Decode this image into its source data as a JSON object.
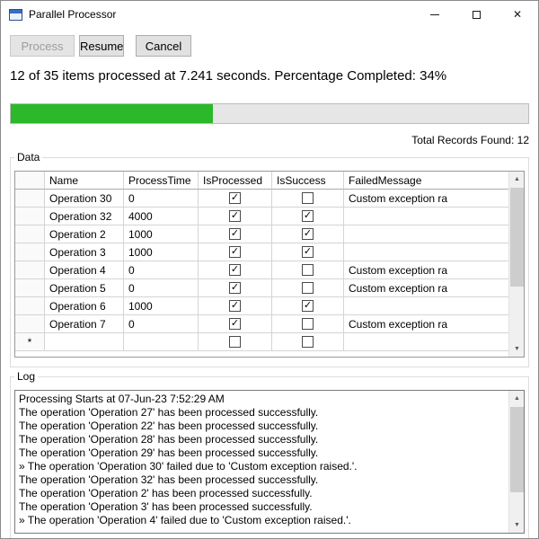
{
  "window": {
    "title": "Parallel Processor"
  },
  "toolbar": {
    "process_label": "Process",
    "resume_label": "Resume",
    "cancel_label": "Cancel"
  },
  "status": {
    "text": "12 of 35 items processed at 7.241 seconds. Percentage Completed: 34%",
    "progress_percent": 34,
    "progress_fill_percent": 39,
    "progress_color": "#2bb82b",
    "total_records": "Total Records Found: 12"
  },
  "data_group": {
    "label": "Data",
    "columns": [
      "Name",
      "ProcessTime",
      "IsProcessed",
      "IsSuccess",
      "FailedMessage"
    ],
    "rows": [
      {
        "row_header": "",
        "name": "Operation 30",
        "process_time": "0",
        "is_processed": true,
        "is_success": false,
        "failed_message": "Custom exception ra"
      },
      {
        "row_header": "",
        "name": "Operation 32",
        "process_time": "4000",
        "is_processed": true,
        "is_success": true,
        "failed_message": ""
      },
      {
        "row_header": "",
        "name": "Operation 2",
        "process_time": "1000",
        "is_processed": true,
        "is_success": true,
        "failed_message": ""
      },
      {
        "row_header": "",
        "name": "Operation 3",
        "process_time": "1000",
        "is_processed": true,
        "is_success": true,
        "failed_message": ""
      },
      {
        "row_header": "",
        "name": "Operation 4",
        "process_time": "0",
        "is_processed": true,
        "is_success": false,
        "failed_message": "Custom exception ra"
      },
      {
        "row_header": "",
        "name": "Operation 5",
        "process_time": "0",
        "is_processed": true,
        "is_success": false,
        "failed_message": "Custom exception ra"
      },
      {
        "row_header": "",
        "name": "Operation 6",
        "process_time": "1000",
        "is_processed": true,
        "is_success": true,
        "failed_message": ""
      },
      {
        "row_header": "",
        "name": "Operation 7",
        "process_time": "0",
        "is_processed": true,
        "is_success": false,
        "failed_message": "Custom exception ra"
      },
      {
        "row_header": "*",
        "name": "",
        "process_time": "",
        "is_processed": false,
        "is_success": false,
        "failed_message": ""
      }
    ]
  },
  "log_group": {
    "label": "Log",
    "lines": [
      "Processing Starts at 07-Jun-23 7:52:29 AM",
      "The operation 'Operation 27' has been processed successfully.",
      "The operation 'Operation 22' has been processed successfully.",
      "The operation 'Operation 28' has been processed successfully.",
      "The operation 'Operation 29' has been processed successfully.",
      "» The operation 'Operation 30' failed due to 'Custom exception raised.'.",
      "The operation 'Operation 32' has been processed successfully.",
      "The operation 'Operation 2' has been processed successfully.",
      "The operation 'Operation 3' has been processed successfully.",
      "» The operation 'Operation 4' failed due to 'Custom exception raised.'."
    ]
  },
  "scrollbar": {
    "up_glyph": "▲",
    "down_glyph": "▼"
  }
}
